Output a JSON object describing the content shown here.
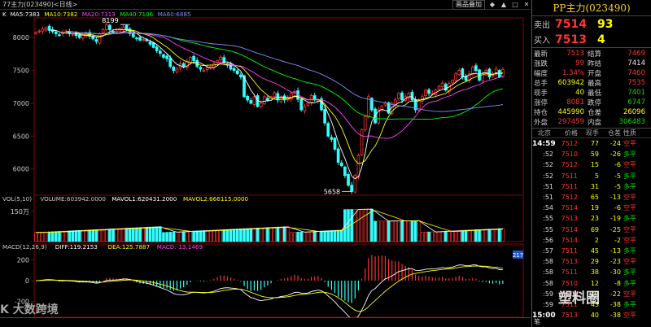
{
  "window": {
    "title": "77主力(023490)<日线>",
    "link_label": "画品叠加",
    "controls": [
      "◆",
      "▲",
      "□",
      "✕"
    ]
  },
  "panel": {
    "title": "PP主力(023490)",
    "sell": {
      "label": "卖出",
      "price": "7514",
      "qty": "93"
    },
    "buy": {
      "label": "买入",
      "price": "7513",
      "qty": "4"
    },
    "quote": [
      {
        "l1": "最新",
        "v1": "7513",
        "c1": "red",
        "l2": "结算",
        "v2": "7469",
        "c2": "red"
      },
      {
        "l1": "涨跌",
        "v1": "99",
        "c1": "red",
        "l2": "昨结",
        "v2": "7414",
        "c2": "white"
      },
      {
        "l1": "幅度",
        "v1": "1.34%",
        "c1": "red",
        "l2": "开盘",
        "v2": "7460",
        "c2": "red"
      },
      {
        "l1": "总手",
        "v1": "603942",
        "c1": "yellow",
        "l2": "最高",
        "v2": "7535",
        "c2": "red"
      },
      {
        "l1": "现手",
        "v1": "40",
        "c1": "yellow",
        "l2": "最低",
        "v2": "7401",
        "c2": "green"
      },
      {
        "l1": "涨停",
        "v1": "8081",
        "c1": "red",
        "l2": "跌停",
        "v2": "6747",
        "c2": "green"
      },
      {
        "l1": "持仓",
        "v1": "445990",
        "c1": "yellow",
        "l2": "仓差",
        "v2": "26096",
        "c2": "yellow"
      },
      {
        "l1": "外盘",
        "v1": "297459",
        "c1": "red",
        "l2": "内盘",
        "v2": "306483",
        "c2": "green"
      }
    ],
    "ticks_header": [
      "北京",
      "价格",
      "现手",
      "仓差",
      "性质"
    ],
    "ticks": [
      {
        "t": "14:59",
        "p": "7512",
        "v": "77",
        "o": "-24",
        "k": "空平",
        "kc": "red",
        "oc": "yellow",
        "bold": true
      },
      {
        "t": ":52",
        "p": "7510",
        "v": "59",
        "o": "-26",
        "k": "多平",
        "kc": "green",
        "oc": "yellow"
      },
      {
        "t": ":52",
        "p": "7512",
        "v": "15",
        "o": "-6",
        "k": "空平",
        "kc": "red",
        "oc": "yellow"
      },
      {
        "t": ":52",
        "p": "7511",
        "v": "5",
        "o": "-5",
        "k": "多平",
        "kc": "green",
        "oc": "yellow"
      },
      {
        "t": ":51",
        "p": "7511",
        "v": "31",
        "o": "-5",
        "k": "多平",
        "kc": "green",
        "oc": "yellow"
      },
      {
        "t": ":51",
        "p": "7512",
        "v": "65",
        "o": "-13",
        "k": "空平",
        "kc": "red",
        "oc": "yellow"
      },
      {
        "t": ":54",
        "p": "7514",
        "v": "19",
        "o": "-6",
        "k": "空平",
        "kc": "red",
        "oc": "yellow"
      },
      {
        "t": ":55",
        "p": "7513",
        "v": "23",
        "o": "-19",
        "k": "多平",
        "kc": "green",
        "oc": "yellow"
      },
      {
        "t": ":55",
        "p": "7514",
        "v": "69",
        "o": "-25",
        "k": "空平",
        "kc": "red",
        "oc": "yellow"
      },
      {
        "t": ":56",
        "p": "7514",
        "v": "2",
        "o": "-2",
        "k": "空平",
        "kc": "red",
        "oc": "yellow"
      },
      {
        "t": ":57",
        "p": "7511",
        "v": "45",
        "o": "-13",
        "k": "多平",
        "kc": "green",
        "oc": "yellow"
      },
      {
        "t": ":58",
        "p": "7513",
        "v": "29",
        "o": "-23",
        "k": "空平",
        "kc": "red",
        "oc": "yellow"
      },
      {
        "t": ":58",
        "p": "7511",
        "v": "38",
        "o": "-30",
        "k": "多平",
        "kc": "green",
        "oc": "yellow"
      },
      {
        "t": ":58",
        "p": "7510",
        "v": "12",
        "o": "-8",
        "k": "多平",
        "kc": "green",
        "oc": "yellow"
      },
      {
        "t": ":59",
        "p": "7512",
        "v": "17",
        "o": "-22",
        "k": "空平",
        "kc": "red",
        "oc": "yellow"
      },
      {
        "t": ":59",
        "p": "7511",
        "v": "43",
        "o": "-38",
        "k": "多平",
        "kc": "green",
        "oc": "yellow"
      },
      {
        "t": "15:00",
        "p": "7513",
        "v": "40",
        "o": "-38",
        "k": "空平",
        "kc": "red",
        "oc": "yellow",
        "bold": true
      }
    ],
    "side_note": "笔"
  },
  "watermark_left": "K 大数跨境",
  "watermark_right": "塑料圈",
  "chart_data": [
    {
      "type": "candlestick",
      "legend_text": "K  MA5:7383  MA10:7382  MA20:7313  MA40:7106  MA60:6885",
      "legend": [
        {
          "name": "K",
          "color": "#ffffff"
        },
        {
          "name": "MA5:7383",
          "color": "#ffffff"
        },
        {
          "name": "MA10:7382",
          "color": "#ffff00"
        },
        {
          "name": "MA20:7313",
          "color": "#ff44ff"
        },
        {
          "name": "MA40:7106",
          "color": "#00ff00"
        },
        {
          "name": "MA60:6885",
          "color": "#8888ff"
        }
      ],
      "y_ticks": [
        "8000",
        "7500",
        "7000",
        "6500",
        "6000"
      ],
      "ylim": [
        5600,
        8300
      ],
      "x_labels": [
        "12",
        "202001",
        "02",
        "03",
        "04",
        "05",
        "06"
      ],
      "annotations": [
        {
          "label": "8199",
          "x": 28,
          "y": 8199
        },
        {
          "label": "5658",
          "x": 94,
          "y": 5658
        }
      ],
      "closes": [
        8080,
        8100,
        8130,
        8150,
        8110,
        8090,
        8060,
        8040,
        8070,
        8100,
        8060,
        8050,
        8030,
        8000,
        8040,
        8060,
        8020,
        7980,
        7940,
        8060,
        8120,
        8199,
        8120,
        8080,
        8100,
        8130,
        8160,
        8120,
        8060,
        8010,
        7980,
        7960,
        7970,
        7950,
        7900,
        7850,
        7800,
        7760,
        7700,
        7680,
        7560,
        7500,
        7520,
        7600,
        7560,
        7640,
        7700,
        7650,
        7560,
        7520,
        7500,
        7540,
        7560,
        7600,
        7650,
        7700,
        7620,
        7580,
        7520,
        7500,
        7450,
        7400,
        7100,
        7050,
        7000,
        7100,
        6950,
        7000,
        7100,
        7050,
        7100,
        7160,
        7050,
        7100,
        7050,
        7080,
        7150,
        7180,
        7060,
        6900,
        6950,
        7000,
        7120,
        7050,
        7050,
        6900,
        6700,
        6500,
        6450,
        6300,
        6100,
        6050,
        5900,
        5750,
        5658,
        5900,
        6200,
        6600,
        6800,
        7100,
        6900,
        6700,
        6900,
        6950,
        7000,
        6850,
        7000,
        7050,
        7150,
        7050,
        7100,
        7150,
        7050,
        6900,
        7050,
        7100,
        7200,
        7150,
        7150,
        7200,
        7250,
        7300,
        7200,
        7300,
        7350,
        7450,
        7500,
        7400,
        7350,
        7450,
        7550,
        7500,
        7350,
        7450,
        7500,
        7400,
        7450,
        7520,
        7400,
        7513
      ]
    },
    {
      "type": "bar",
      "legend_text": "VOL(5,10)  VOLUME:603942.0000  MAVOL1:620431.2000  MAVOL2:666115.0000",
      "legend": [
        {
          "name": "VOL(5,10)",
          "color": "#cccccc"
        },
        {
          "name": "VOLUME:603942.0000",
          "color": "#cccccc"
        },
        {
          "name": "MAVOL1:620431.2000",
          "color": "#ffffff"
        },
        {
          "name": "MAVOL2:666115.0000",
          "color": "#ffff00"
        }
      ],
      "y_ticks": [
        "150万"
      ],
      "ylim": [
        0,
        2300000
      ]
    },
    {
      "type": "bar",
      "legend_text": "MACD(12,26,9)  DIFF:119.2153  DEA:125.7887  MACD:-13.1469",
      "legend": [
        {
          "name": "MACD(12,26,9)",
          "color": "#cccccc"
        },
        {
          "name": "DIFF:119.2153",
          "color": "#ffffff"
        },
        {
          "name": "DEA:125.7887",
          "color": "#ffff00"
        },
        {
          "name": "MACD:-13.1469",
          "color": "#ff44ff"
        }
      ],
      "y_ticks": [
        "200",
        "0",
        "-200"
      ],
      "ylim": [
        -350,
        350
      ],
      "badge": "217"
    }
  ]
}
